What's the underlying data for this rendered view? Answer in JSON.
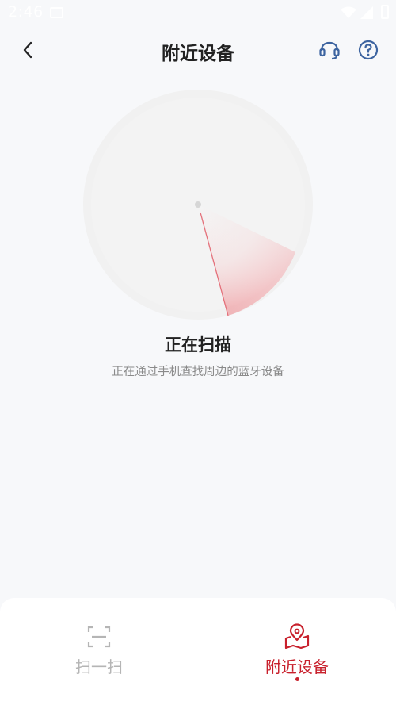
{
  "status_bar": {
    "time": "2:46"
  },
  "header": {
    "title": "附近设备"
  },
  "scanning": {
    "title": "正在扫描",
    "description": "正在通过手机查找周边的蓝牙设备"
  },
  "tabs": [
    {
      "label": "扫一扫",
      "active": false
    },
    {
      "label": "附近设备",
      "active": true
    }
  ],
  "colors": {
    "accent": "#c8202c",
    "icon_blue": "#3d64a0",
    "inactive": "#b5b5b5",
    "background": "#f7f8fa"
  }
}
